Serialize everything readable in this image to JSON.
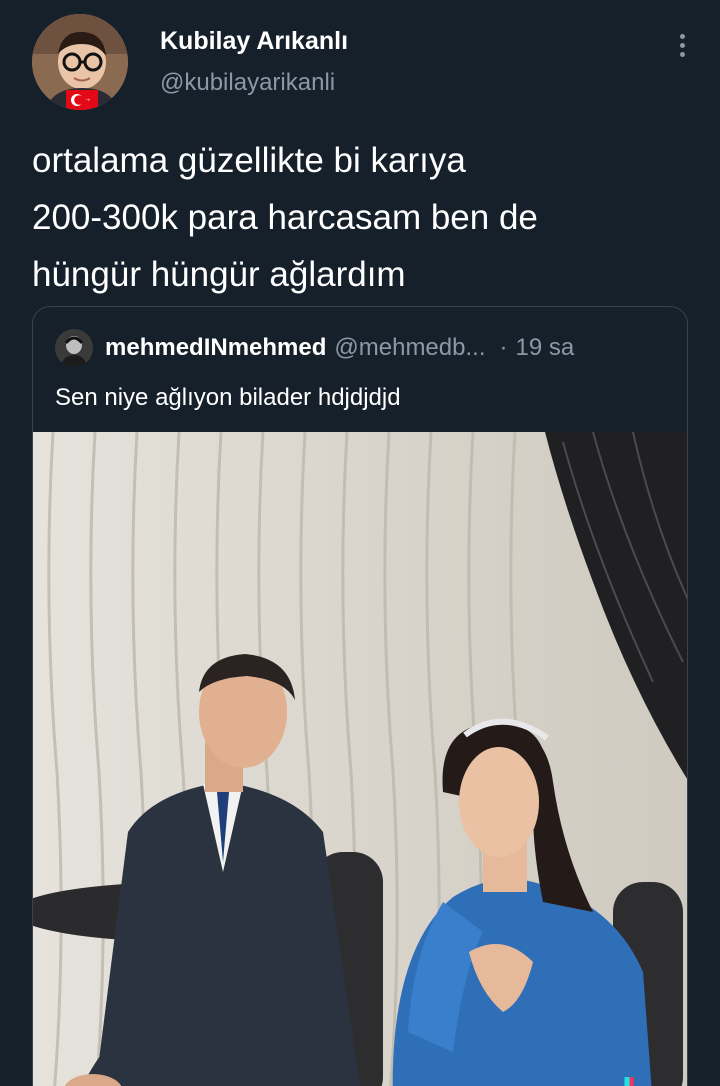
{
  "author": {
    "display_name": "Kubilay Arıkanlı",
    "handle": "@kubilayarikanli"
  },
  "tweet": {
    "text": "ortalama güzellikte bi karıya\n200-300k para harcasam ben de\nhüngür hüngür ağlardım"
  },
  "quoted_tweet": {
    "display_name": "mehmedINmehmed",
    "handle": "@mehmedb...",
    "separator": "·",
    "time": "19 sa",
    "text": "Sen niye ağlıyon bilader hdjdjdjd"
  },
  "colors": {
    "background": "#15202b",
    "secondary_text": "#8b98a5",
    "border": "#38444d"
  },
  "icons": {
    "more": "more-vertical-icon",
    "flag": "turkish-flag-icon"
  }
}
